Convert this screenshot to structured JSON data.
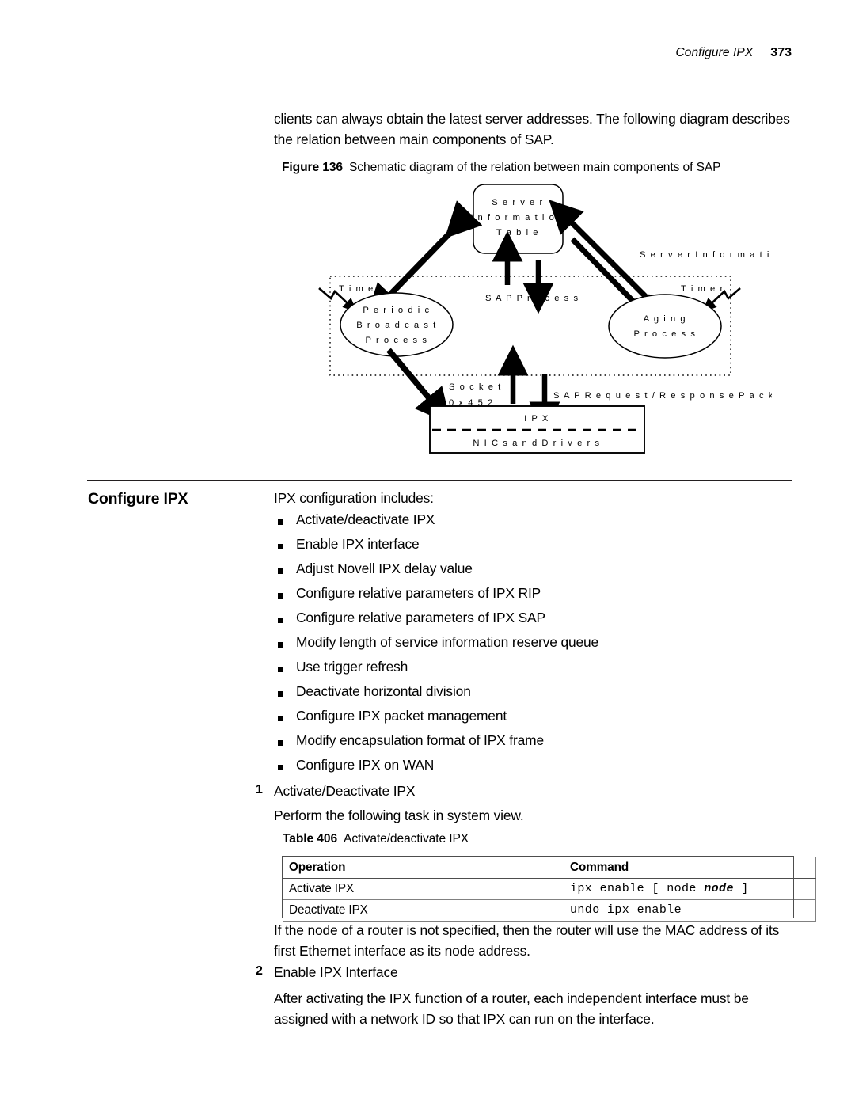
{
  "header": {
    "title": "Configure IPX",
    "page_number": "373"
  },
  "intro_paragraph": "clients can always obtain the latest server addresses. The following diagram describes the relation between main components of SAP.",
  "figure": {
    "label": "Figure 136",
    "caption": "Schematic diagram of the relation between main components of SAP",
    "nodes": {
      "server_info_table": "Server Information Table",
      "server_info_table_l1": "S e r v e r",
      "server_info_table_l2": "I n f o r m a t i o n",
      "server_info_table_l3": "T a b l e",
      "sap_process": "S A P  P r o c e s s",
      "periodic_l1": "P e r i o d i c",
      "periodic_l2": "B r o a d c a s t",
      "periodic_l3": "P r o c e s s",
      "aging_l1": "A g i n g",
      "aging_l2": "P r o c e s s",
      "timer_left": "T i m e r",
      "timer_right": "T i m e r",
      "server_information": "S e r v e r  I n f o r m a t i o n",
      "socket_l1": "S o c k e t",
      "socket_l2": "0 x 4 5 2",
      "sap_packets": "S A P  R e q u e s t / R e s p o n s e  P a c k e t s",
      "ipx": "I P X",
      "nics": "N I C s  a n d  D r i v e r s"
    }
  },
  "section": {
    "heading": "Configure IPX",
    "lead": "IPX configuration includes:",
    "bullets": [
      "Activate/deactivate IPX",
      "Enable IPX interface",
      "Adjust Novell IPX delay value",
      "Configure relative parameters of IPX RIP",
      "Configure relative parameters of IPX SAP",
      "Modify length of service information reserve queue",
      "Use trigger refresh",
      "Deactivate horizontal division",
      "Configure IPX packet management",
      "Modify encapsulation format of IPX frame",
      "Configure IPX on WAN"
    ]
  },
  "steps": {
    "step1_num": "1",
    "step1_title": "Activate/Deactivate IPX",
    "step1_body": "Perform the following task in system view.",
    "step2_num": "2",
    "step2_title": "Enable IPX Interface",
    "step2_body": "After activating the IPX function of a router, each independent interface must be assigned with a network ID so that IPX can run on the interface."
  },
  "table": {
    "label": "Table 406",
    "caption": "Activate/deactivate IPX",
    "headers": [
      "Operation",
      "Command"
    ],
    "rows": [
      {
        "operation": "Activate IPX",
        "command_pre": "ipx enable [ node ",
        "command_var": "node",
        "command_post": " ]"
      },
      {
        "operation": "Deactivate IPX",
        "command_pre": "undo ipx enable",
        "command_var": "",
        "command_post": ""
      }
    ]
  },
  "note_paragraph": "If the node of a router is not specified, then the router will use the MAC address of its first Ethernet interface as its node address."
}
